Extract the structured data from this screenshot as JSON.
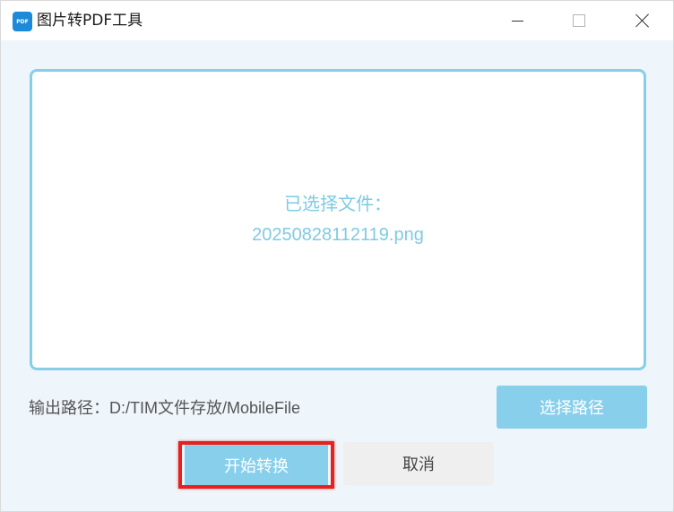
{
  "window": {
    "title": "图片转PDF工具",
    "icon_label": "PDF",
    "icon": "pdf-app-icon"
  },
  "titlebar_buttons": {
    "minimize_icon": "minimize-icon",
    "maximize_icon": "maximize-icon",
    "close_icon": "close-icon"
  },
  "drop_area": {
    "line1": "已选择文件：",
    "line2": "20250828112119.png"
  },
  "output": {
    "label": "输出路径：D:/TIM文件存放/MobileFile"
  },
  "buttons": {
    "choose_path": "选择路径",
    "start": "开始转换",
    "cancel": "取消"
  },
  "colors": {
    "accent": "#88cfec",
    "drop_border": "#86cfe8",
    "drop_text": "#7ecbe3",
    "highlight": "#e8201e",
    "background": "#eef5fb",
    "app_icon": "#1c8ad8"
  }
}
